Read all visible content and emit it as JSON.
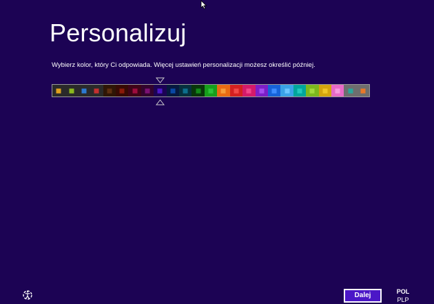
{
  "page": {
    "title": "Personalizuj",
    "instruction": "Wybierz kolor, który Ci odpowiada. Więcej ustawień personalizacji możesz określić później.",
    "background_color": "#1c0354"
  },
  "color_picker": {
    "selected_index": 8,
    "swatches": [
      {
        "bg": "#2a2a2a",
        "chip": "#e1a11e"
      },
      {
        "bg": "#2a2a2a",
        "chip": "#8ab91e"
      },
      {
        "bg": "#2a2a2a",
        "chip": "#2d7ad3"
      },
      {
        "bg": "#2a2a2a",
        "chip": "#c53030"
      },
      {
        "bg": "#2e1606",
        "chip": "#5e2f10"
      },
      {
        "bg": "#360a04",
        "chip": "#8a1a0a"
      },
      {
        "bg": "#3e0418",
        "chip": "#9e0c3e"
      },
      {
        "bg": "#32042e",
        "chip": "#7b1174"
      },
      {
        "bg": "#1c0354",
        "chip": "#4b17c7"
      },
      {
        "bg": "#06193f",
        "chip": "#0a48a5"
      },
      {
        "bg": "#06303e",
        "chip": "#0d6f8e"
      },
      {
        "bg": "#09360a",
        "chip": "#138a1a"
      },
      {
        "bg": "#179e1c",
        "chip": "#2bc43a"
      },
      {
        "bg": "#ea6b13",
        "chip": "#f79d3a"
      },
      {
        "bg": "#d42020",
        "chip": "#f24848"
      },
      {
        "bg": "#d41a6a",
        "chip": "#f0458c"
      },
      {
        "bg": "#7d1fc8",
        "chip": "#a54cf0"
      },
      {
        "bg": "#1763d8",
        "chip": "#3e8cff"
      },
      {
        "bg": "#3aa3e6",
        "chip": "#6cc6ff"
      },
      {
        "bg": "#00a69c",
        "chip": "#22c8bc"
      },
      {
        "bg": "#7cb81e",
        "chip": "#a2da3c"
      },
      {
        "bg": "#d4a40e",
        "chip": "#f0c628"
      },
      {
        "bg": "#e86ac8",
        "chip": "#f79ae0"
      },
      {
        "bg": "#6e6e6e",
        "chip": "#2aa69c"
      },
      {
        "bg": "#6e6e6e",
        "chip": "#e8782a"
      }
    ]
  },
  "footer": {
    "next_label": "Dalej",
    "language_code": "POL",
    "keyboard_layout": "PLP"
  },
  "icons": {
    "cursor": "mouse-pointer-icon",
    "ease_of_access": "ease-of-access-icon",
    "slider_top": "triangle-down-icon",
    "slider_bottom": "triangle-up-icon"
  }
}
